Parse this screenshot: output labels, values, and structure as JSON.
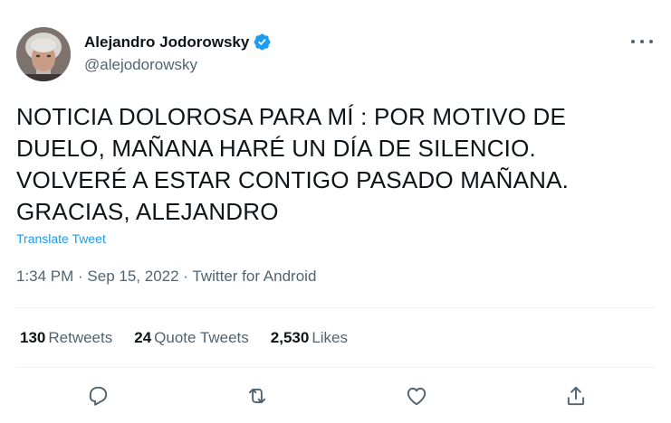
{
  "author": {
    "display_name": "Alejandro Jodorowsky",
    "handle": "@alejodorowsky",
    "verified": true
  },
  "tweet": {
    "text": "NOTICIA DOLOROSA PARA MÍ : POR MOTIVO DE DUELO, MAÑANA HARÉ UN DÍA DE SILENCIO. VOLVERÉ A ESTAR CONTIGO PASADO MAÑANA. GRACIAS, ALEJANDRO",
    "translate_label": "Translate Tweet",
    "time": "1:34 PM",
    "date": "Sep 15, 2022",
    "source": "Twitter for Android",
    "separator": " · "
  },
  "stats": {
    "retweets": {
      "count": "130",
      "label": "Retweets"
    },
    "quote_tweets": {
      "count": "24",
      "label": "Quote Tweets"
    },
    "likes": {
      "count": "2,530",
      "label": "Likes"
    }
  },
  "actions": [
    "reply-icon",
    "retweet-icon",
    "like-icon",
    "share-icon"
  ],
  "colors": {
    "text": "#0f1419",
    "secondary": "#536471",
    "accent": "#1d9bf0",
    "divider": "#eff3f4"
  }
}
